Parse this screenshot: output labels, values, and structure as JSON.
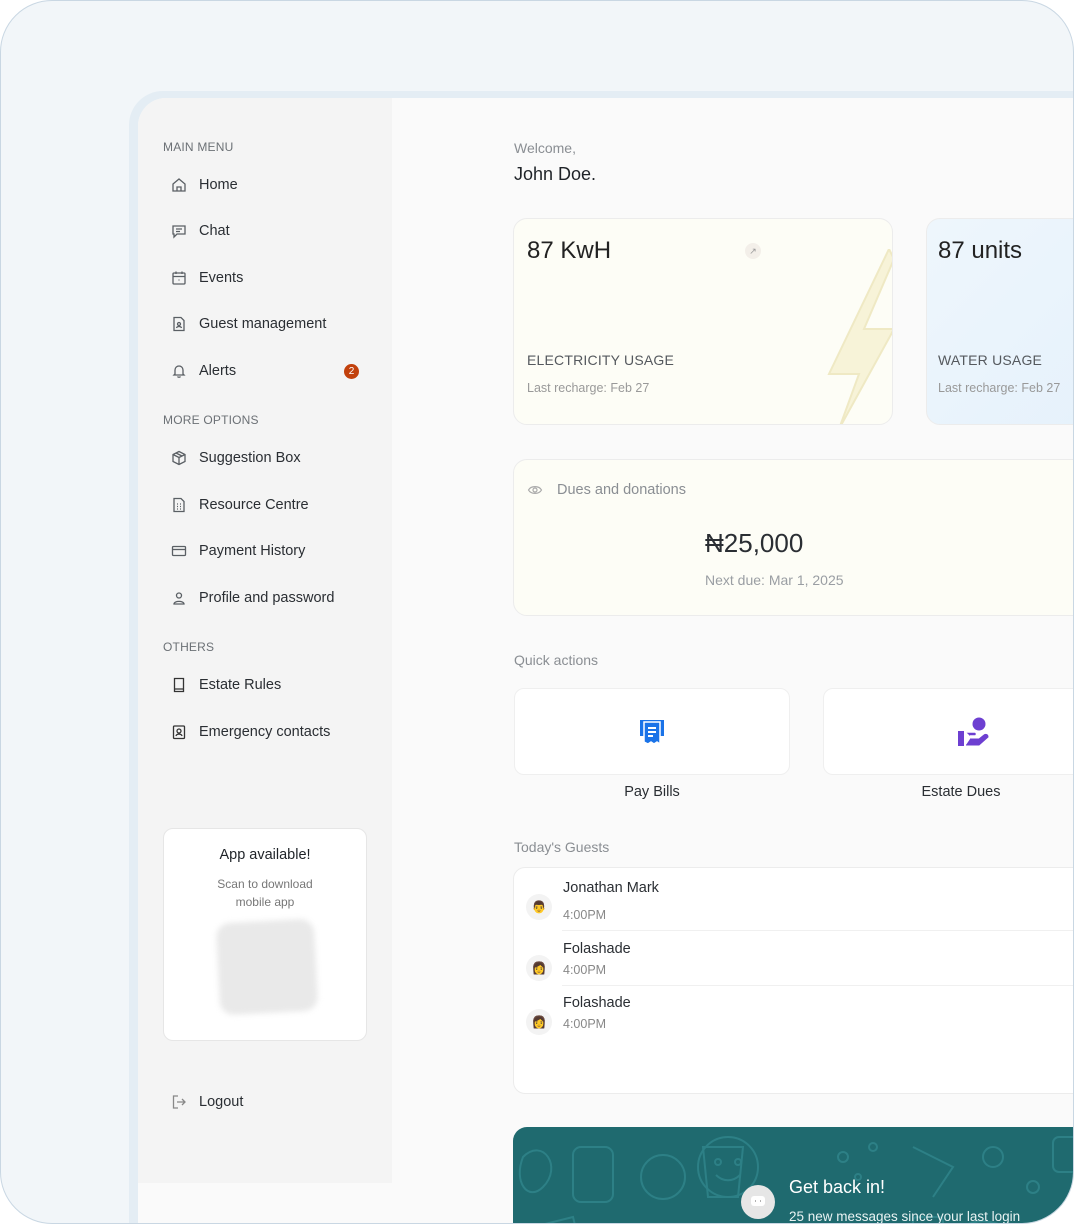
{
  "sidebar": {
    "sections": {
      "main": "MAIN MENU",
      "more": "MORE OPTIONS",
      "others": "OTHERS"
    },
    "items": {
      "home": "Home",
      "chat": "Chat",
      "events": "Events",
      "guest": "Guest management",
      "alerts": "Alerts",
      "suggestion": "Suggestion Box",
      "resource": "Resource Centre",
      "payment": "Payment History",
      "profile": "Profile and password",
      "rules": "Estate Rules",
      "emergency": "Emergency contacts",
      "logout": "Logout"
    },
    "alerts_badge": "2",
    "app_card": {
      "title": "App available!",
      "subtitle": "Scan to download mobile app"
    }
  },
  "header": {
    "greeting": "Welcome,",
    "name": "John Doe."
  },
  "electricity": {
    "value": "87 KwH",
    "label": "ELECTRICITY USAGE",
    "last": "Last recharge: Feb 27"
  },
  "water": {
    "value": "87 units",
    "label": "WATER USAGE",
    "last": "Last recharge: Feb 27"
  },
  "dues": {
    "title": "Dues and donations",
    "amount": "₦25,000",
    "next": "Next due: Mar 1, 2025"
  },
  "quick_actions": {
    "title": "Quick actions",
    "pay_bills": "Pay Bills",
    "estate_dues": "Estate Dues",
    "colors": {
      "pay": "#1a73e8",
      "dues": "#6d3fd1"
    }
  },
  "guests": {
    "title": "Today's Guests",
    "list": [
      {
        "name": "Jonathan Mark",
        "time": "4:00PM",
        "avatar": "👨"
      },
      {
        "name": "Folashade",
        "time": "4:00PM",
        "avatar": "👩"
      },
      {
        "name": "Folashade",
        "time": "4:00PM",
        "avatar": "👩"
      }
    ]
  },
  "banner": {
    "title": "Get back in!",
    "subtitle": "25 new messages since your last login"
  },
  "colors": {
    "badge": "#c2410c",
    "banner": "#1f6a6f"
  }
}
